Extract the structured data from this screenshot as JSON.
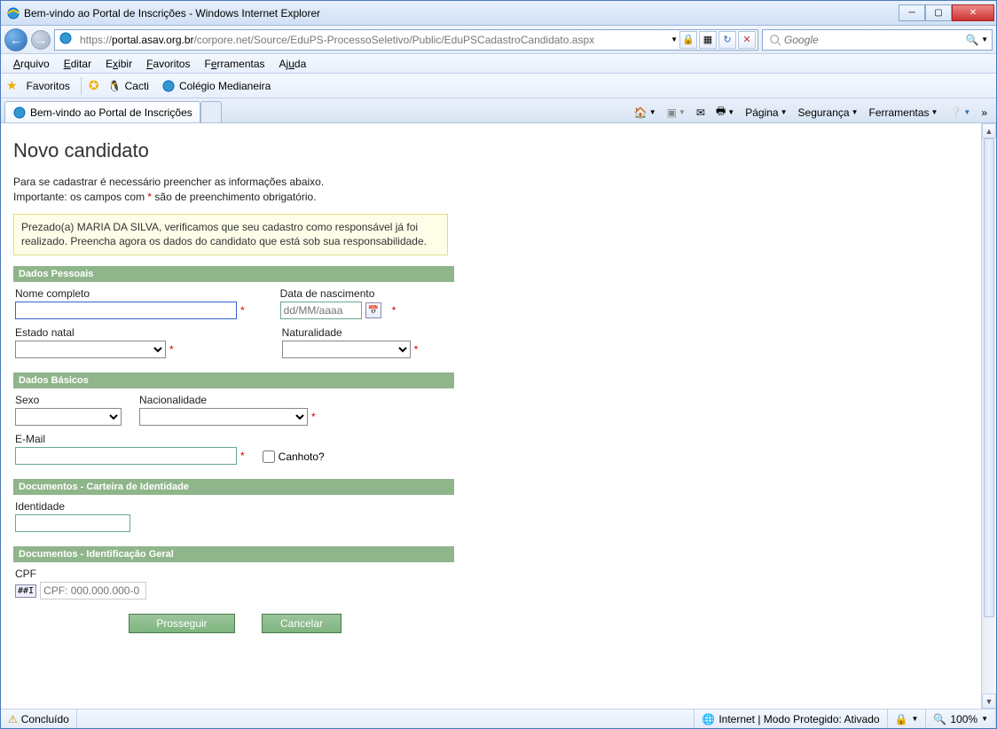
{
  "window": {
    "title": "Bem-vindo ao Portal de Inscrições - Windows Internet Explorer",
    "url_gray_prefix": "https://",
    "url_host": "portal.asav.org.br",
    "url_path": "/corpore.net/Source/EduPS-ProcessoSeletivo/Public/EduPSCadastroCandidato.aspx",
    "search_placeholder": "Google"
  },
  "menu": {
    "arquivo": "Arquivo",
    "editar": "Editar",
    "exibir": "Exibir",
    "favoritos": "Favoritos",
    "ferramentas": "Ferramentas",
    "ajuda": "Ajuda"
  },
  "favbar": {
    "favoritos": "Favoritos",
    "cacti": "Cacti",
    "colegio": "Colégio Medianeira"
  },
  "tab": {
    "title": "Bem-vindo ao Portal de Inscrições"
  },
  "toolbar": {
    "pagina": "Página",
    "seguranca": "Segurança",
    "ferramentas": "Ferramentas"
  },
  "page": {
    "title": "Novo candidato",
    "intro_line1": "Para se cadastrar é necessário preencher as informações abaixo.",
    "intro_line2_a": "Importante: os campos com ",
    "intro_line2_b": " são de preenchimento obrigatório.",
    "notice": "Prezado(a) MARIA DA SILVA, verificamos que seu cadastro como responsável já foi realizado. Preencha agora os dados do candidato que está sob sua responsabilidade.",
    "sec_dados_pessoais": "Dados Pessoais",
    "lbl_nome": "Nome completo",
    "lbl_data": "Data de nascimento",
    "ph_data": "dd/MM/aaaa",
    "lbl_estado": "Estado natal",
    "lbl_naturalidade": "Naturalidade",
    "sec_dados_basicos": "Dados Básicos",
    "lbl_sexo": "Sexo",
    "lbl_nacionalidade": "Nacionalidade",
    "lbl_email": "E-Mail",
    "lbl_canhoto": "Canhoto?",
    "sec_doc_id": "Documentos - Carteira de Identidade",
    "lbl_identidade": "Identidade",
    "sec_doc_geral": "Documentos - Identificação Geral",
    "lbl_cpf": "CPF",
    "ph_cpf": "CPF: 000.000.000-0",
    "hash_icon": "##I",
    "btn_prosseguir": "Prosseguir",
    "btn_cancelar": "Cancelar"
  },
  "status": {
    "concluido": "Concluído",
    "zone": "Internet | Modo Protegido: Ativado",
    "zoom": "100%"
  }
}
